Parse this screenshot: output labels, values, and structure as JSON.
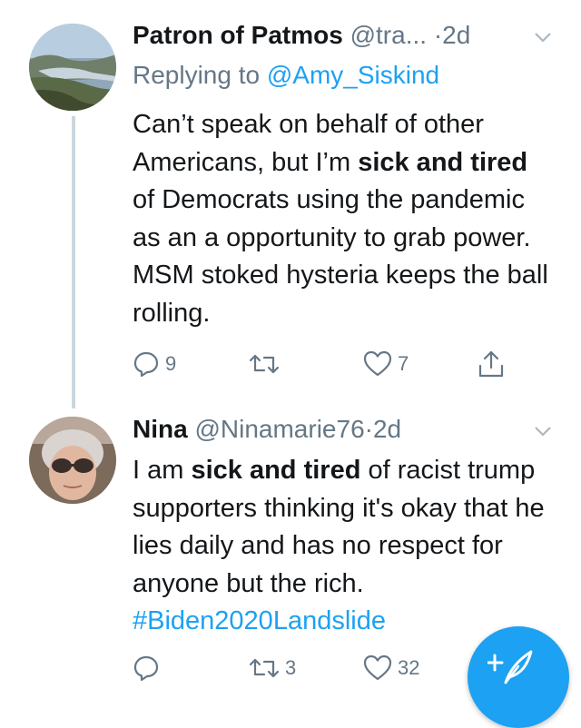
{
  "tweets": [
    {
      "name": "Patron of Patmos",
      "handle": "@tra...",
      "dot": "·",
      "time": "2d",
      "reply_label": "Replying to",
      "reply_mention": "@Amy_Siskind",
      "text_1": "Can’t speak on behalf of other Americans, but I’m ",
      "text_bold": "sick and tired",
      "text_2": " of Democrats using the pandemic as an a opportunity to grab power. MSM stoked hysteria keeps the ball rolling.",
      "reply_count": "9",
      "retweet_count": "",
      "like_count": "7",
      "icons": [
        "caret-down-icon",
        "reply-icon",
        "retweet-icon",
        "like-icon",
        "share-icon"
      ]
    },
    {
      "name": "Nina",
      "handle": "@Ninamarie76",
      "dot": "·",
      "time": "2d",
      "text_1": "I am ",
      "text_bold": "sick and tired",
      "text_2": " of racist trump supporters thinking it's okay that he lies daily and has no respect for anyone but the rich. ",
      "hashtag": "#Biden2020Landslide",
      "reply_count": "",
      "retweet_count": "3",
      "like_count": "32",
      "icons": [
        "caret-down-icon",
        "reply-icon",
        "retweet-icon",
        "like-icon"
      ]
    }
  ],
  "compose_button": {
    "icon": "compose-feather-icon"
  },
  "colors": {
    "text": "#14171a",
    "secondary": "#657786",
    "accent": "#1da1f2",
    "thread_line": "#ccd6dd"
  }
}
